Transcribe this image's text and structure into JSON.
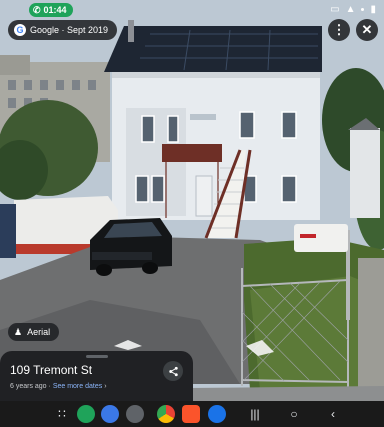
{
  "statusbar": {
    "call_time": "01:44",
    "cast_icon": "cast-icon",
    "signal_icon": "signal-icon",
    "battery_icon": "battery-icon"
  },
  "imagery": {
    "source": "Google · Sept 2019"
  },
  "top_actions": {
    "more_icon": "more-vert-icon",
    "close_icon": "close-icon"
  },
  "layers": {
    "aerial_label": "Aerial"
  },
  "place": {
    "address": "109 Tremont St",
    "age": "6 years ago · ",
    "more_dates": "See more dates",
    "chevron": "›"
  },
  "dock": {
    "apps": [
      "launcher-icon",
      "phone-app-icon",
      "messages-app-icon",
      "camera-app-icon",
      "chrome-app-icon",
      "brave-app-icon",
      "edge-app-icon"
    ],
    "keys": [
      "recents-key",
      "home-key",
      "back-key"
    ]
  },
  "colors": {
    "sky": "#b9c6d2",
    "house": "#e7ebef",
    "roof_solar": "#1e2633",
    "panel_dark": "#202124",
    "call_green": "#1fa35a",
    "link_blue": "#8ab4f8"
  }
}
